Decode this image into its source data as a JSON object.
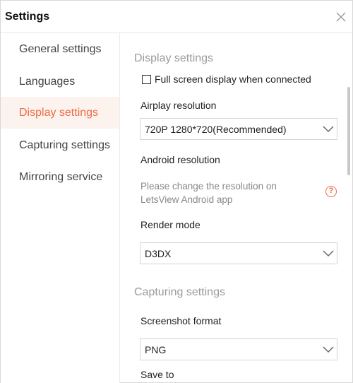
{
  "window": {
    "title": "Settings"
  },
  "sidebar": {
    "items": [
      {
        "label": "General settings"
      },
      {
        "label": "Languages"
      },
      {
        "label": "Display settings"
      },
      {
        "label": "Capturing settings"
      },
      {
        "label": "Mirroring service"
      }
    ],
    "active_index": 2
  },
  "display": {
    "section_title": "Display settings",
    "fullscreen_label": "Full screen display when connected",
    "fullscreen_checked": false,
    "airplay_label": "Airplay resolution",
    "airplay_value": "720P 1280*720(Recommended)",
    "android_label": "Android resolution",
    "android_hint": "Please change the resolution on LetsView Android app",
    "help_icon": "?",
    "render_label": "Render mode",
    "render_value": "D3DX"
  },
  "capturing": {
    "section_title": "Capturing settings",
    "screenshot_label": "Screenshot format",
    "screenshot_value": "PNG",
    "save_to_label": "Save to"
  },
  "colors": {
    "accent": "#ef6a45",
    "active_bg": "#fcf2ee"
  }
}
